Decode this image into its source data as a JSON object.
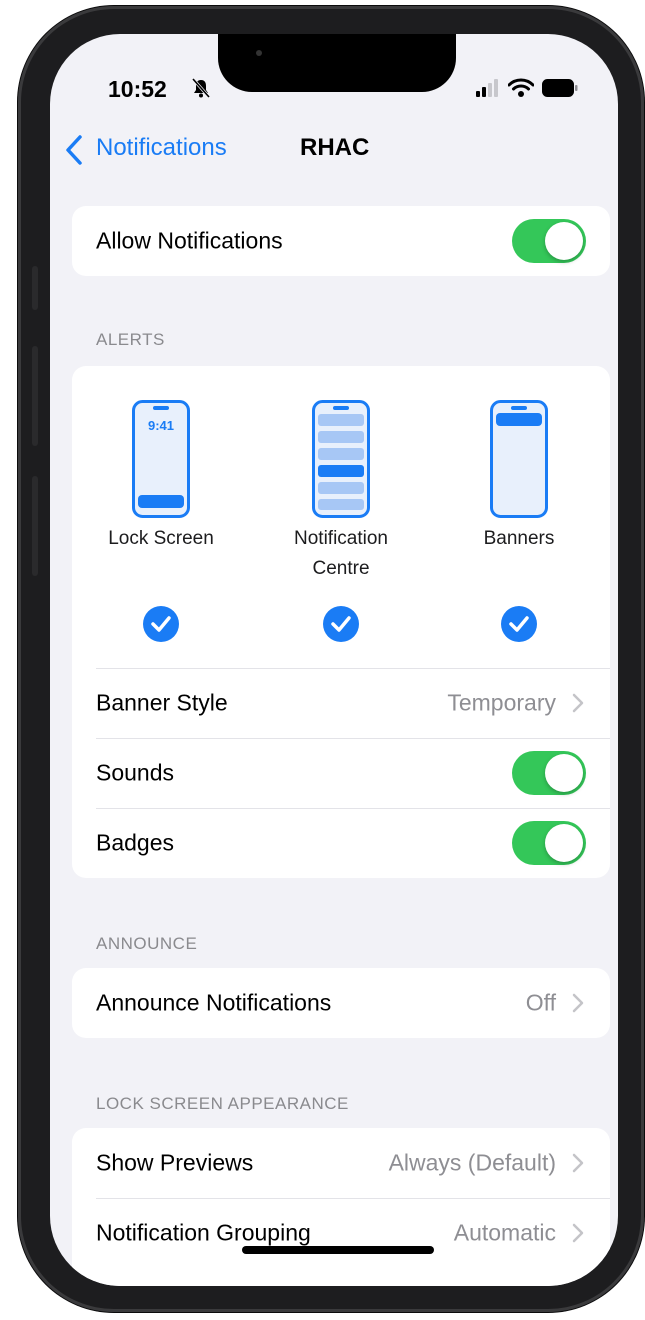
{
  "status_bar": {
    "time": "10:52"
  },
  "nav": {
    "back_label": "Notifications",
    "title": "RHAC"
  },
  "allow_notifications": {
    "label": "Allow Notifications",
    "on": true
  },
  "alerts": {
    "header": "ALERTS",
    "options": [
      {
        "label": "Lock Screen",
        "checked": true,
        "preview_time": "9:41"
      },
      {
        "label": "Notification",
        "label_line2": "Centre",
        "checked": true
      },
      {
        "label": "Banners",
        "checked": true
      }
    ],
    "banner_style": {
      "label": "Banner Style",
      "value": "Temporary"
    },
    "sounds": {
      "label": "Sounds",
      "on": true
    },
    "badges": {
      "label": "Badges",
      "on": true
    }
  },
  "announce": {
    "header": "ANNOUNCE",
    "announce_notifications": {
      "label": "Announce Notifications",
      "value": "Off"
    }
  },
  "lock_screen_appearance": {
    "header": "LOCK SCREEN APPEARANCE",
    "show_previews": {
      "label": "Show Previews",
      "value": "Always (Default)"
    },
    "notification_grouping": {
      "label": "Notification Grouping",
      "value": "Automatic"
    }
  },
  "colors": {
    "accent": "#1a7cf5",
    "toggle_on": "#34c759",
    "background": "#f2f2f7"
  }
}
